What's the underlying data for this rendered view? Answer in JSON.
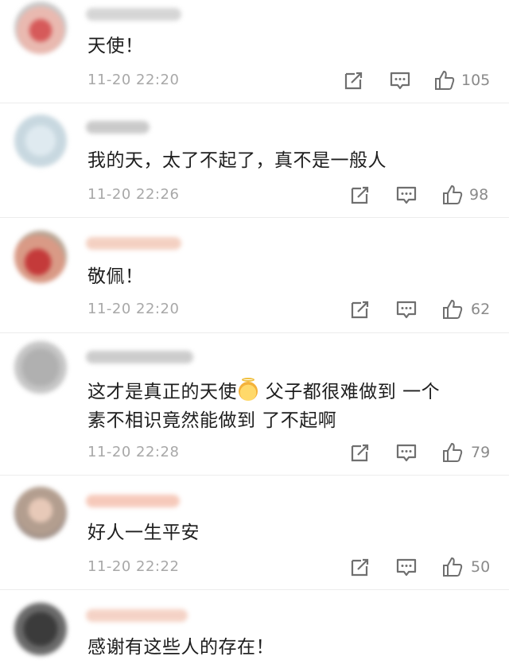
{
  "colors": {
    "timestamp": "#a8a8a8",
    "icon": "#6f6f6f",
    "divider": "#ececec"
  },
  "comments": [
    {
      "text": "天使！",
      "timestamp": "11-20 22:20",
      "likes": "105",
      "icons": [
        "share-icon",
        "reply-icon",
        "like-icon"
      ]
    },
    {
      "text": "我的天，太了不起了，真不是一般人",
      "timestamp": "11-20 22:26",
      "likes": "98",
      "icons": [
        "share-icon",
        "reply-icon",
        "like-icon"
      ]
    },
    {
      "text": "敬佩！",
      "timestamp": "11-20 22:20",
      "likes": "62",
      "icons": [
        "share-icon",
        "reply-icon",
        "like-icon"
      ]
    },
    {
      "text_line1_part1": "这才是真正的天使",
      "emoji": "angel-emoji",
      "text_line1_part2": " 父子都很难做到 一个",
      "text_line2": "素不相识竟然能做到 了不起啊",
      "timestamp": "11-20 22:28",
      "likes": "79",
      "icons": [
        "share-icon",
        "reply-icon",
        "like-icon"
      ]
    },
    {
      "text": "好人一生平安",
      "timestamp": "11-20 22:22",
      "likes": "50",
      "icons": [
        "share-icon",
        "reply-icon",
        "like-icon"
      ]
    },
    {
      "text": "感谢有这些人的存在！"
    }
  ]
}
